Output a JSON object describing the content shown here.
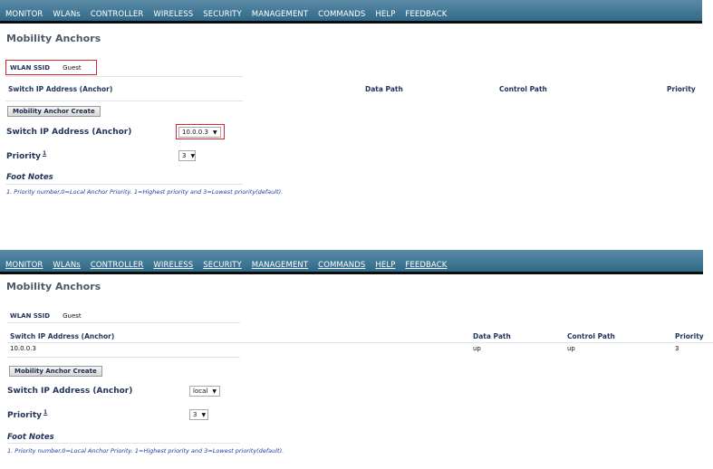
{
  "colors": {
    "nav_bar": "#2f6a89",
    "highlight": "#d9262c",
    "label": "#23355a",
    "footnote_text": "#1f3ea0"
  },
  "panels": [
    {
      "nav": [
        "MONITOR",
        "WLANs",
        "CONTROLLER",
        "WIRELESS",
        "SECURITY",
        "MANAGEMENT",
        "COMMANDS",
        "HELP",
        "FEEDBACK"
      ],
      "page_title": "Mobility Anchors",
      "wlan_ssid_label": "WLAN SSID",
      "wlan_ssid_value": "Guest",
      "columns": {
        "switch_ip": "Switch IP Address (Anchor)",
        "data_path": "Data Path",
        "control_path": "Control Path",
        "priority": "Priority"
      },
      "rows": [],
      "create_button": "Mobility Anchor Create",
      "switch_ip_label": "Switch IP Address (Anchor)",
      "switch_ip_selected": "10.0.0.3",
      "priority_label": "Priority",
      "priority_footnote": "1",
      "priority_selected": "3",
      "foot_notes_title": "Foot Notes",
      "foot_note_1": "1. Priority number,0=Local Anchor Priority. 1=Highest priority and 3=Lowest priority(default)."
    },
    {
      "nav": [
        "MONITOR",
        "WLANs",
        "CONTROLLER",
        "WIRELESS",
        "SECURITY",
        "MANAGEMENT",
        "COMMANDS",
        "HELP",
        "FEEDBACK"
      ],
      "page_title": "Mobility Anchors",
      "wlan_ssid_label": "WLAN SSID",
      "wlan_ssid_value": "Guest",
      "columns": {
        "switch_ip": "Switch IP Address (Anchor)",
        "data_path": "Data Path",
        "control_path": "Control Path",
        "priority": "Priority"
      },
      "rows": [
        {
          "switch_ip": "10.0.0.3",
          "data_path": "up",
          "control_path": "up",
          "priority": "3"
        }
      ],
      "create_button": "Mobility Anchor Create",
      "switch_ip_label": "Switch IP Address (Anchor)",
      "switch_ip_selected": "local",
      "priority_label": "Priority",
      "priority_footnote": "1",
      "priority_selected": "3",
      "foot_notes_title": "Foot Notes",
      "foot_note_1": "1. Priority number,0=Local Anchor Priority. 1=Highest priority and 3=Lowest priority(default)."
    }
  ]
}
